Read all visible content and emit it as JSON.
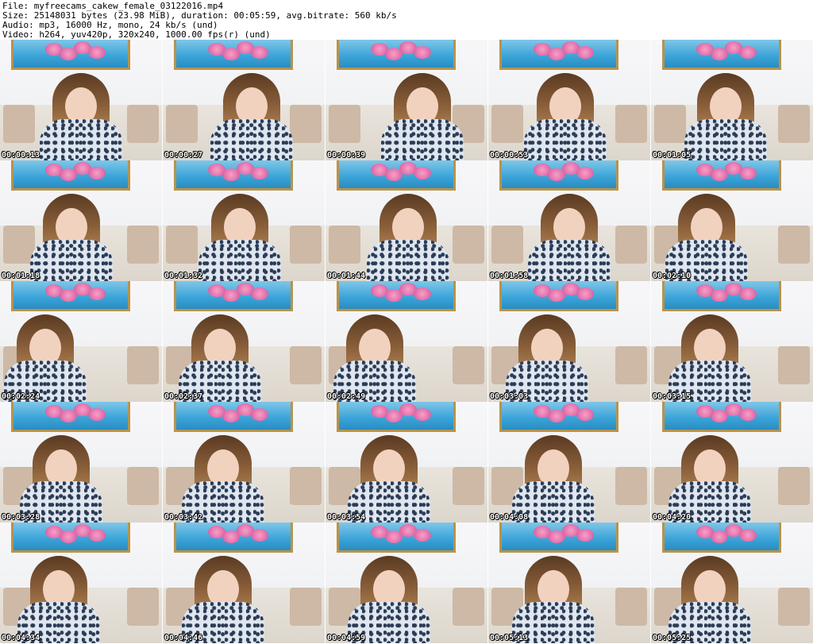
{
  "header": {
    "line1": "File: myfreecams_cakew_female_03122016.mp4",
    "line2": "Size: 25148031 bytes (23.98 MiB), duration: 00:05:59, avg.bitrate: 560 kb/s",
    "line3": "Audio: mp3, 16000 Hz, mono, 24 kb/s (und)",
    "line4": "Video: h264, yuv420p, 320x240, 1000.00 fps(r) (und)"
  },
  "thumbnails": [
    {
      "time": "00:00:13"
    },
    {
      "time": "00:00:27"
    },
    {
      "time": "00:00:39"
    },
    {
      "time": "00:00:53"
    },
    {
      "time": "00:01:05"
    },
    {
      "time": "00:01:18"
    },
    {
      "time": "00:01:32"
    },
    {
      "time": "00:01:44"
    },
    {
      "time": "00:01:58"
    },
    {
      "time": "00:02:10"
    },
    {
      "time": "00:02:24"
    },
    {
      "time": "00:02:37"
    },
    {
      "time": "00:02:49"
    },
    {
      "time": "00:03:03"
    },
    {
      "time": "00:03:15"
    },
    {
      "time": "00:03:28"
    },
    {
      "time": "00:03:42"
    },
    {
      "time": "00:03:54"
    },
    {
      "time": "00:04:08"
    },
    {
      "time": "00:04:20"
    },
    {
      "time": "00:04:34"
    },
    {
      "time": "00:04:46"
    },
    {
      "time": "00:04:59"
    },
    {
      "time": "00:05:13"
    },
    {
      "time": "00:05:25"
    }
  ]
}
